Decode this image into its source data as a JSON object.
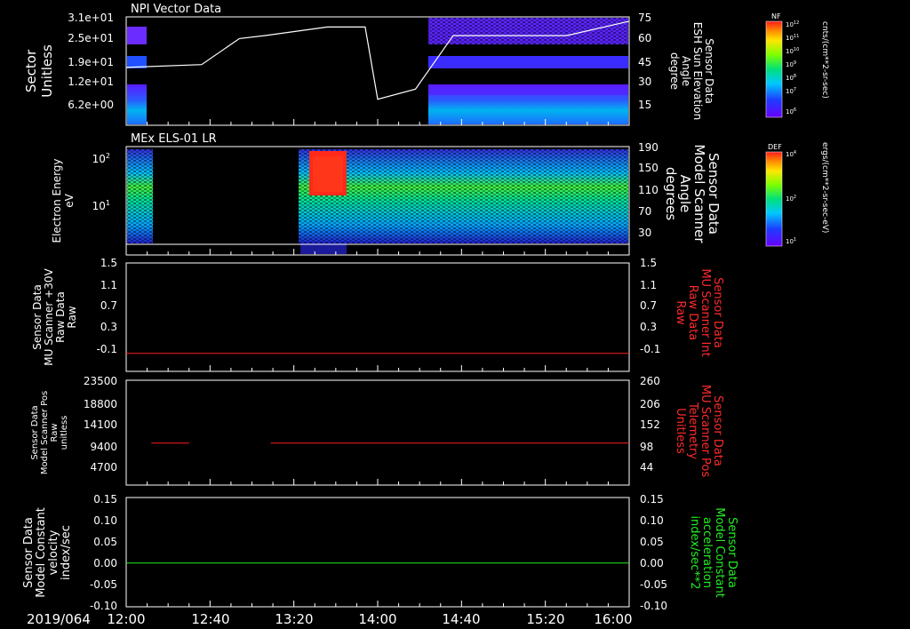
{
  "panels": [
    {
      "id": "npi",
      "title": "NPI Vector Data",
      "left_label_lines": [
        "Sector",
        "Unitless"
      ],
      "left_ticks": [
        "3.1e+01",
        "2.5e+01",
        "1.9e+01",
        "1.2e+01",
        "6.2e+00"
      ],
      "right_label_lines": [
        "Sensor Data",
        "ESH Sun Elevation",
        "Angle",
        "degree"
      ],
      "right_ticks": [
        "75",
        "60",
        "45",
        "30",
        "15"
      ],
      "right_label_color": "#ffffff"
    },
    {
      "id": "els",
      "title": "MEx ELS-01 LR",
      "left_label_lines": [
        "Electron Energy",
        "eV"
      ],
      "left_ticks": [
        "10",
        "10"
      ],
      "left_tick_exponents": [
        "2",
        "1"
      ],
      "right_label_lines": [
        "Sensor Data",
        "Model Scanner",
        "Angle",
        "degrees"
      ],
      "right_ticks": [
        "190",
        "150",
        "110",
        "70",
        "30"
      ],
      "right_label_color": "#ffffff"
    },
    {
      "id": "mu30",
      "title": "",
      "left_label_lines": [
        "Sensor Data",
        "MU Scanner +30V",
        "Raw Data",
        "Raw"
      ],
      "left_ticks": [
        "1.5",
        "1.1",
        "0.7",
        "0.3",
        "-0.1"
      ],
      "right_label_lines": [
        "Sensor Data",
        "MU Scanner Int",
        "Raw Data",
        "Raw"
      ],
      "right_ticks": [
        "1.5",
        "1.1",
        "0.7",
        "0.3",
        "-0.1"
      ],
      "right_label_color": "#ff2a2a"
    },
    {
      "id": "pos",
      "title": "",
      "left_label_lines": [
        "Sensor Data",
        "Model Scanner Pos",
        "Raw",
        "unitless"
      ],
      "left_ticks": [
        "23500",
        "18800",
        "14100",
        "9400",
        "4700"
      ],
      "right_label_lines": [
        "Sensor Data",
        "MU Scanner Pos",
        "Telemetry",
        "Unitless"
      ],
      "right_ticks": [
        "260",
        "206",
        "152",
        "98",
        "44"
      ],
      "right_label_color": "#ff2a2a"
    },
    {
      "id": "model",
      "title": "",
      "left_label_lines": [
        "Sensor Data",
        "Model Constant",
        "velocity",
        "index/sec"
      ],
      "left_ticks": [
        "0.15",
        "0.10",
        "0.05",
        "0.00",
        "-0.05",
        "-0.10"
      ],
      "right_label_lines": [
        "Sensor Data",
        "Model Constant",
        "acceleration",
        "index/sec**2"
      ],
      "right_ticks": [
        "0.15",
        "0.10",
        "0.05",
        "0.00",
        "-0.05",
        "-0.10"
      ],
      "right_label_color": "#22ee22"
    }
  ],
  "x_axis": {
    "date_label": "2019/064",
    "ticks": [
      "12:00",
      "12:40",
      "13:20",
      "14:00",
      "14:40",
      "15:20",
      "16:00"
    ]
  },
  "colorbars": [
    {
      "id": "nf",
      "title": "NF",
      "unit": "cnts/(cm**2-sr-sec)",
      "ticks": [
        "10",
        "10",
        "10",
        "10",
        "10",
        "10",
        "10"
      ],
      "exponents": [
        "12",
        "11",
        "10",
        "9",
        "8",
        "7",
        "6"
      ]
    },
    {
      "id": "def",
      "title": "DEF",
      "unit": "ergs/(cm**2-sr-sec-eV)",
      "ticks": [
        "10",
        "10",
        "10"
      ],
      "exponents": [
        "4",
        "2",
        "1"
      ]
    }
  ],
  "colors": {
    "background": "#000000",
    "axis": "#ffffff",
    "red_trace": "#ff2020",
    "green_trace": "#22ee22"
  },
  "chart_data": [
    {
      "type": "line",
      "panel": "npi",
      "name": "Sun Elevation Angle",
      "x_hours": [
        12.0,
        12.6,
        12.9,
        13.1,
        13.6,
        13.9,
        14.0,
        14.3,
        14.6,
        14.9,
        15.5,
        16.0
      ],
      "values": [
        40,
        42,
        60,
        62,
        68,
        68,
        18,
        25,
        62,
        62,
        62,
        72
      ],
      "ylim": [
        0,
        75
      ]
    },
    {
      "type": "line",
      "panel": "mu30",
      "name": "MU Scanner +30V",
      "x_hours": [
        12.0,
        16.0
      ],
      "values": [
        0.0,
        0.0
      ],
      "ylim": [
        -0.3,
        1.5
      ]
    },
    {
      "type": "line",
      "panel": "pos",
      "name": "Model Scanner Pos",
      "segments": [
        {
          "x_hours": [
            12.2,
            12.5
          ],
          "values": [
            9400,
            9400
          ]
        },
        {
          "x_hours": [
            13.15,
            16.0
          ],
          "values": [
            9400,
            9400
          ]
        }
      ],
      "ylim": [
        0,
        23500
      ]
    },
    {
      "type": "line",
      "panel": "model",
      "name": "Model Constant velocity",
      "x_hours": [
        12.0,
        16.0
      ],
      "values": [
        0.0,
        0.0
      ],
      "ylim": [
        -0.1,
        0.15
      ]
    },
    {
      "type": "heatmap",
      "panel": "npi",
      "coverage_hours": [
        [
          12.0,
          12.2
        ],
        [
          14.4,
          16.0
        ]
      ]
    },
    {
      "type": "heatmap",
      "panel": "els",
      "coverage_hours": [
        [
          12.0,
          12.2
        ],
        [
          13.4,
          16.0
        ]
      ]
    }
  ]
}
